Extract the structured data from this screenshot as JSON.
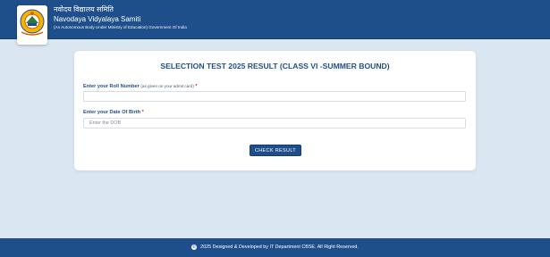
{
  "header": {
    "org_hindi": "नवोदय विद्यालय समिति",
    "org_name": "Navodaya Vidyalaya Samiti",
    "org_subtitle": "(An Autonomous Body Under Ministry of Education) Government Of India",
    "logo_icon": "nvs-emblem-icon",
    "logo_text": "प्रज्ञानम् ब्रह्म"
  },
  "form": {
    "title": "SELECTION TEST 2025 RESULT (CLASS VI -SUMMER BOUND)",
    "roll_label": "Enter your Roll Number",
    "roll_hint": "(as given on your admit card)",
    "roll_value": "",
    "dob_label": "Enter your Date Of Birth",
    "dob_placeholder": "Enter the DOB",
    "dob_value": "",
    "required_mark": "*",
    "submit_label": "CHECK RESULT"
  },
  "footer": {
    "icon": "copyright-icon",
    "text": "2025 Designed & Developed by IT Department CBSE. All Right Reserved."
  },
  "colors": {
    "primary": "#1f4f8b",
    "background": "#dbe6f3",
    "required": "#d02030"
  }
}
